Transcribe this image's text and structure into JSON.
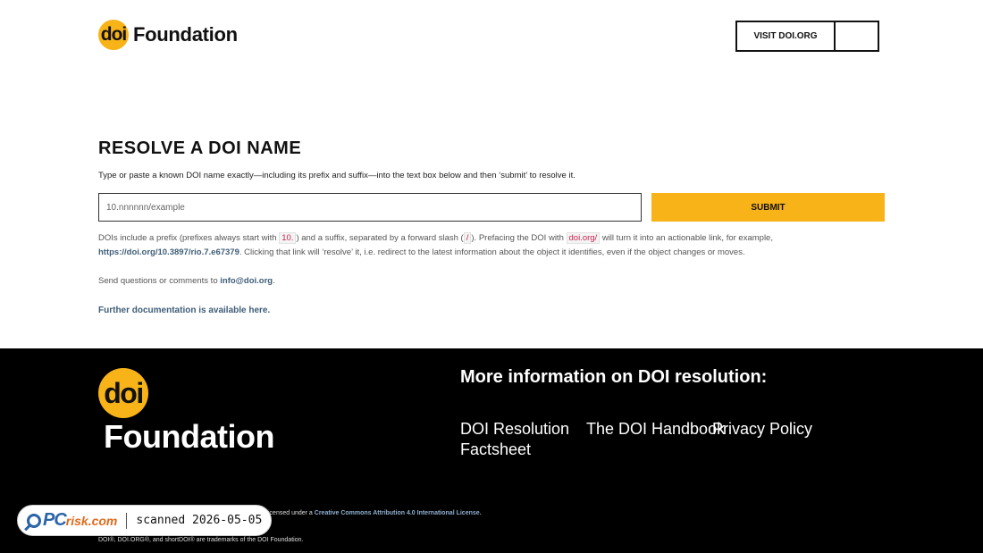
{
  "header": {
    "logo_mark": "doi",
    "logo_word": "Foundation",
    "visit_label": "VISIT DOI.ORG"
  },
  "main": {
    "title": "RESOLVE A DOI NAME",
    "intro": "Type or paste a known DOI name exactly—including its prefix and suffix—into the text box below and then ‘submit’ to resolve it.",
    "input_placeholder": "10.nnnnnn/example",
    "submit_label": "SUBMIT",
    "explain": {
      "p1": "DOIs include a prefix (prefixes always start with ",
      "chip1": "10.",
      "p2": ") and a suffix, separated by a forward slash (",
      "chip2": "/",
      "p3": "). Prefacing the DOI with ",
      "chip3": "doi.org/",
      "p4": " will turn it into an actionable link, for example, ",
      "example_link": "https://doi.org/10.3897/rio.7.e67379",
      "p5": ". Clicking that link will ‘resolve’ it, i.e. redirect to the latest information about the object it identifies, even if the object changes or moves."
    },
    "contact_prefix": "Send questions or comments to ",
    "contact_email": "info@doi.org",
    "contact_suffix": ".",
    "further_docs": "Further documentation is available here."
  },
  "footer": {
    "logo_mark": "doi",
    "logo_word": "Foundation",
    "heading": "More information on DOI resolution:",
    "links": [
      "DOI Resolution Factsheet",
      "The DOI Handbook",
      "Privacy Policy"
    ],
    "license_prefix": "icensed under a ",
    "license_link": "Creative Commons Attribution 4.0 International License.",
    "trademark": "DOI®, DOI.ORG®, and shortDOI® are trademarks of the DOI Foundation."
  },
  "watermark": {
    "logo_main": "PC",
    "logo_small": "risk.com",
    "text": "scanned 2026-05-05"
  },
  "colors": {
    "accent": "#f7b318",
    "link": "#3e5d78",
    "footer_bg": "#000000",
    "code": "#c7254e"
  }
}
